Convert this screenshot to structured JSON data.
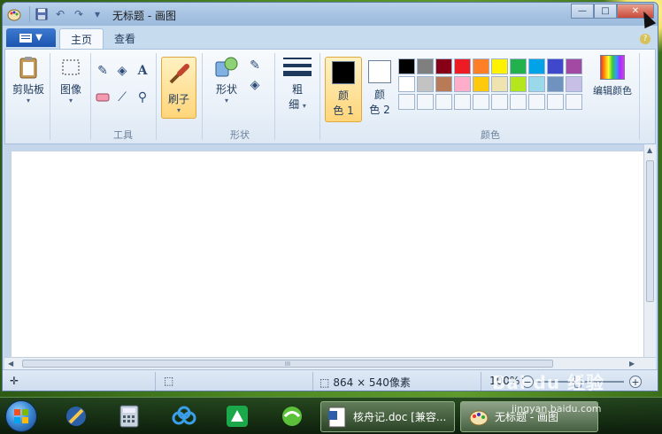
{
  "window": {
    "title": "无标题 - 画图",
    "controls": {
      "minimize": "—",
      "maximize": "□",
      "close": "✕"
    }
  },
  "ribbon_tabs": {
    "file_menu": "▼",
    "home": "主页",
    "view": "查看",
    "help": "?"
  },
  "groups": {
    "clipboard": {
      "label": "剪贴板",
      "chevron": "▾"
    },
    "image": {
      "label": "图像",
      "chevron": "▾"
    },
    "tools": {
      "label": "工具"
    },
    "brush": {
      "label": "刷子",
      "chevron": "▾"
    },
    "shapes": {
      "button": "形状",
      "label": "形状",
      "chevron": "▾"
    },
    "size": {
      "line1": "粗",
      "line2": "细",
      "chevron": "▾"
    },
    "color1": {
      "line1": "颜",
      "line2": "色 1"
    },
    "color2": {
      "line1": "颜",
      "line2": "色 2"
    },
    "colors": {
      "label": "颜色"
    },
    "edit_colors": "编辑颜色"
  },
  "colors": {
    "color1": "#000000",
    "color2": "#ffffff",
    "palette": [
      "#000000",
      "#7f7f7f",
      "#880015",
      "#ed1c24",
      "#ff7f27",
      "#fff200",
      "#22b14c",
      "#00a2e8",
      "#3f48cc",
      "#a349a4",
      "#ffffff",
      "#c3c3c3",
      "#b97a57",
      "#ffaec9",
      "#ffc90e",
      "#efe4b0",
      "#b5e61d",
      "#99d9ea",
      "#7092be",
      "#c8bfe7",
      "#f3f6fa",
      "#f3f6fa",
      "#f3f6fa",
      "#f3f6fa",
      "#f3f6fa",
      "#f3f6fa",
      "#f3f6fa",
      "#f3f6fa",
      "#f3f6fa",
      "#f3f6fa"
    ]
  },
  "scrollbar": {
    "grip": "III"
  },
  "status": {
    "image_size": "864 × 540像素",
    "zoom": "100%",
    "zoom_out": "−",
    "zoom_in": "+"
  },
  "taskbar": {
    "tasks": [
      {
        "label": "核舟记.doc [兼容..."
      },
      {
        "label": "无标题 - 画图"
      }
    ]
  },
  "watermark": {
    "main": "Bai du 经验",
    "sub": "jingyan.baidu.com"
  }
}
